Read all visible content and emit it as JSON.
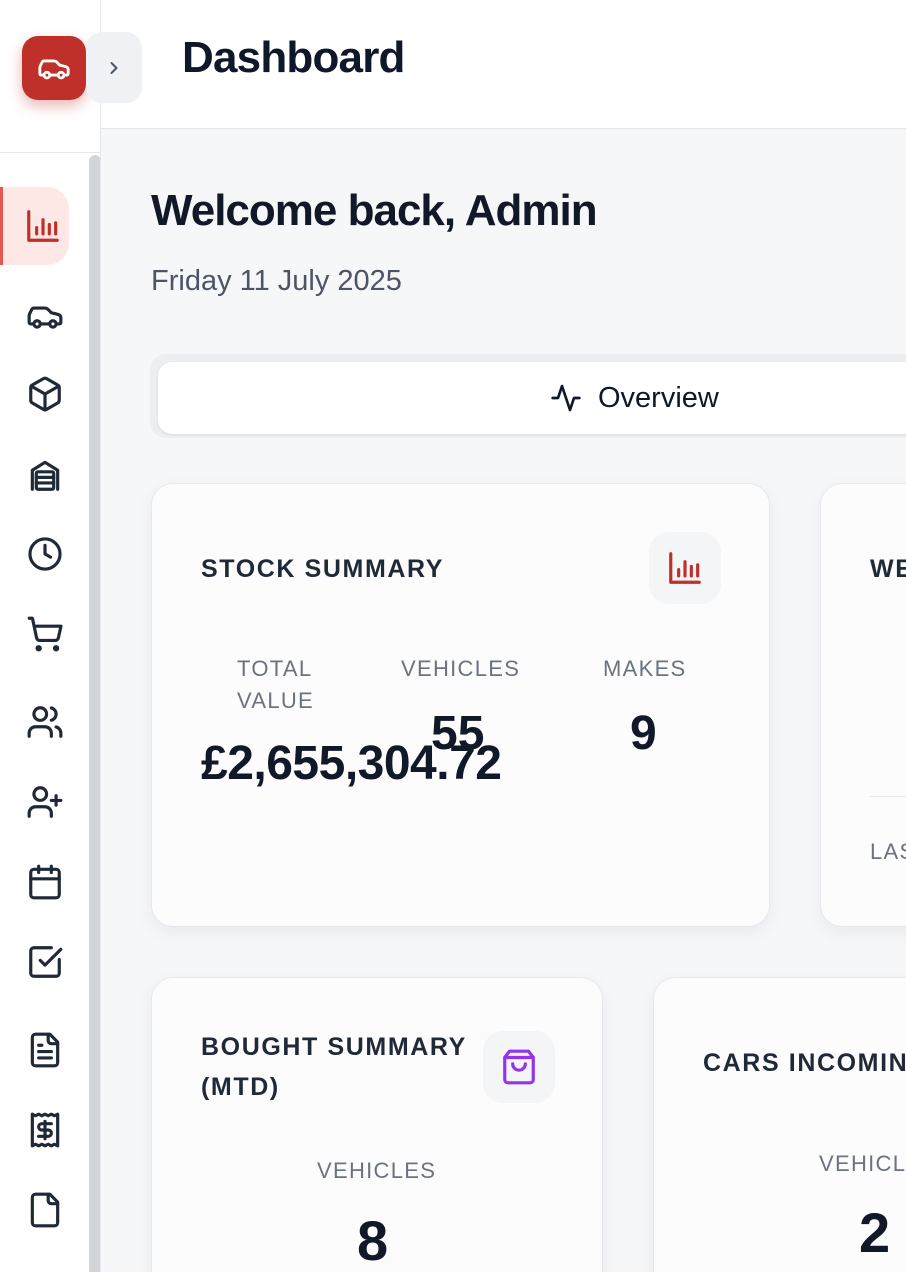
{
  "header": {
    "title": "Dashboard"
  },
  "welcome": {
    "greeting": "Welcome back, Admin",
    "date": "Friday 11 July 2025"
  },
  "tabs": [
    {
      "label": "Overview",
      "icon": "activity-icon",
      "active": true
    }
  ],
  "sidebar": {
    "items": [
      {
        "icon": "bar-chart-icon",
        "active": true
      },
      {
        "icon": "car-icon"
      },
      {
        "icon": "box-icon"
      },
      {
        "icon": "warehouse-icon"
      },
      {
        "icon": "clock-icon"
      },
      {
        "icon": "cart-icon"
      },
      {
        "icon": "users-icon"
      },
      {
        "icon": "user-plus-icon"
      },
      {
        "icon": "calendar-icon"
      },
      {
        "icon": "check-square-icon"
      },
      {
        "icon": "file-text-icon"
      },
      {
        "icon": "receipt-icon"
      },
      {
        "icon": "file-icon"
      }
    ]
  },
  "colors": {
    "brand": "#c0302a",
    "stock_icon": "#c0302a",
    "bought_icon": "#9333ea"
  },
  "cards": {
    "stock_summary": {
      "title": "STOCK SUMMARY",
      "icon": "bar-chart-icon",
      "metrics": [
        {
          "label": "TOTAL VALUE",
          "value": "£2,655,304.72"
        },
        {
          "label": "VEHICLES",
          "value": "55"
        },
        {
          "label": "MAKES",
          "value": "9"
        }
      ]
    },
    "second_card": {
      "title_partial": "WE",
      "footer_partial": "LAS"
    },
    "bought_summary": {
      "title": "BOUGHT SUMMARY (MTD)",
      "icon": "shopping-bag-icon",
      "metric": {
        "label": "VEHICLES",
        "value": "8"
      }
    },
    "cars_incoming": {
      "title_partial": "CARS INCOMIN",
      "metric": {
        "label_partial": "VEHICL",
        "value": "2"
      }
    }
  }
}
